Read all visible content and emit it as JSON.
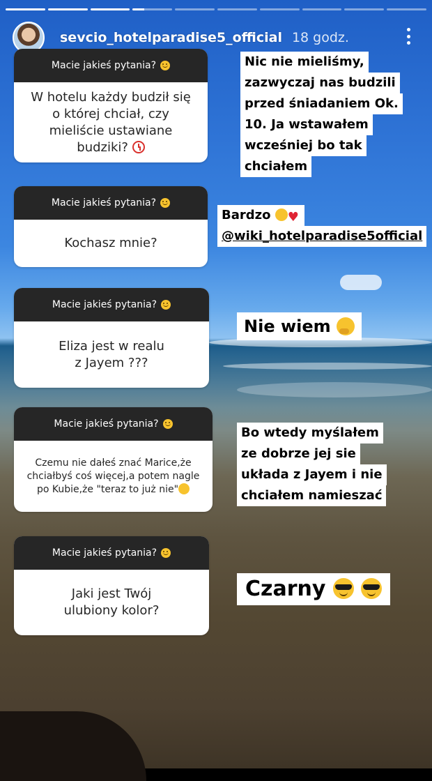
{
  "story": {
    "username": "sevcio_hotelparadise5_official",
    "time": "18 godz.",
    "progress": [
      1,
      1,
      1,
      0.3,
      0,
      0,
      0,
      0,
      0,
      0
    ]
  },
  "qa": [
    {
      "header": "Macie jakieś pytania?",
      "question": "W hotelu każdy budził się o której chciał, czy mieliście ustawiane budziki?",
      "answer_lines": [
        "Nic nie mieliśmy,",
        "zazwyczaj nas budzili",
        "przed śniadaniem Ok.",
        "10. Ja wstawałem",
        "wcześniej bo tak",
        "chciałem"
      ]
    },
    {
      "header": "Macie jakieś pytania?",
      "question": "Kochasz mnie?",
      "answer_lines": [
        "Bardzo",
        "@wiki_hotelparadise5official"
      ]
    },
    {
      "header": "Macie jakieś pytania?",
      "question": "Eliza jest w realu z Jayem ???",
      "answer_lines": [
        "Nie wiem"
      ]
    },
    {
      "header": "Macie jakieś pytania?",
      "question": "Czemu nie dałeś znać Marice,że chciałbyś coś więcej,a potem nagle po Kubie,że \"teraz to już nie\"",
      "answer_lines": [
        "Bo wtedy myślałem",
        "ze dobrze jej sie",
        "układa z Jayem i nie",
        "chciałem namieszać"
      ]
    },
    {
      "header": "Macie jakieś pytania?",
      "question": "Jaki jest Twój ulubiony kolor?",
      "answer_lines": [
        "Czarny"
      ]
    }
  ]
}
